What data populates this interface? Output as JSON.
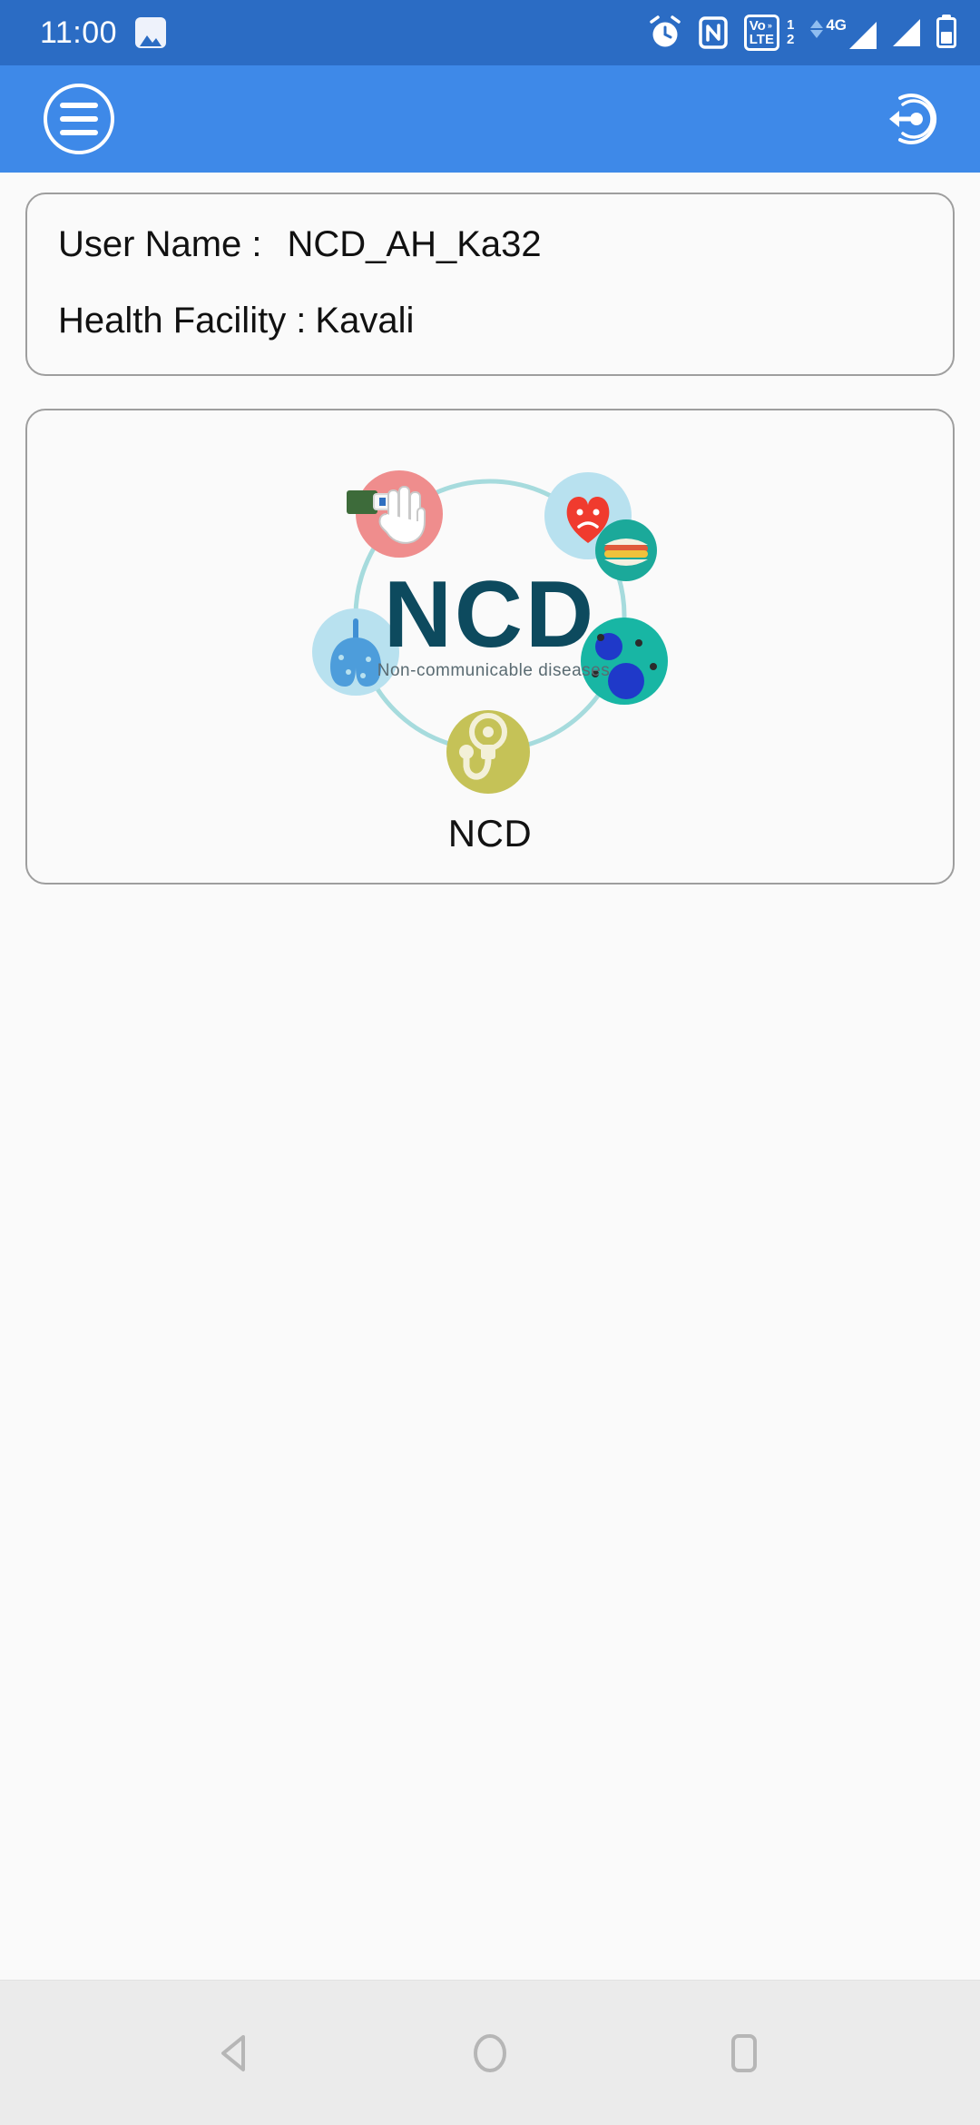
{
  "status_bar": {
    "time": "11:00",
    "left_icons": [
      {
        "name": "screenshot-image-icon",
        "label": "image"
      }
    ],
    "right_icons": [
      {
        "name": "alarm-clock-icon",
        "label": "alarm"
      },
      {
        "name": "nfc-icon",
        "label": "N"
      },
      {
        "name": "volte-icon",
        "label": "Vo LTE",
        "sim_top": "1",
        "sim_bottom": "2"
      },
      {
        "name": "mobile-data-4g-icon",
        "label": "4G"
      },
      {
        "name": "signal-strength-icon",
        "label": "signal"
      },
      {
        "name": "battery-icon",
        "label": "battery"
      }
    ],
    "background_color": "#2b6cc4",
    "foreground_color": "#ffffff"
  },
  "app_bar": {
    "menu_icon": "hamburger-menu-icon",
    "logout_icon": "logout-icon",
    "background_color": "#3e89e8"
  },
  "user_card": {
    "user_name_label": "User Name :",
    "user_name_value": "NCD_AH_Ka32",
    "health_facility_label": "Health Facility :",
    "health_facility_value": "Kavali"
  },
  "module_tile": {
    "label": "NCD",
    "logo": {
      "title": "NCD",
      "subtitle": "Non-communicable diseases",
      "title_color": "#0d4a5e",
      "ring_color": "#a6dbdd",
      "bubbles": [
        {
          "name": "no-smoking-hand-icon",
          "color": "#ef8d8d",
          "position": "top-left"
        },
        {
          "name": "sad-heart-icon",
          "color": "#b8e1ef",
          "position": "top-right"
        },
        {
          "name": "unhealthy-food-icon",
          "color": "#1ba99a",
          "position": "top-right-small"
        },
        {
          "name": "cancer-cell-icon",
          "color": "#18b6a4",
          "position": "right"
        },
        {
          "name": "lungs-icon",
          "color": "#b8e1ef",
          "position": "left"
        },
        {
          "name": "stethoscope-icon",
          "color": "#c5c257",
          "position": "bottom"
        }
      ]
    }
  },
  "navigation_bar": {
    "background_color": "#ebebeb",
    "buttons": [
      {
        "name": "back-button",
        "label": "Back"
      },
      {
        "name": "home-button",
        "label": "Home"
      },
      {
        "name": "recents-button",
        "label": "Recents"
      }
    ]
  }
}
